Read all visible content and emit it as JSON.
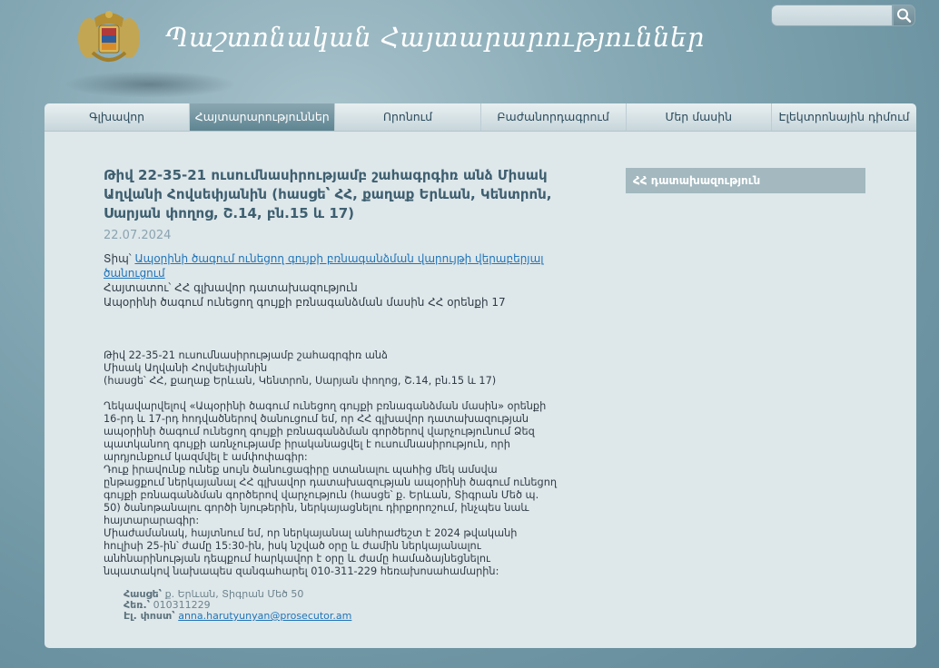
{
  "header": {
    "site_title": "Պաշտոնական Հայտարարություններ",
    "search": {
      "placeholder": "",
      "value": ""
    },
    "colors": {
      "accent": "#5f8592",
      "background": "#86a9b5"
    }
  },
  "nav": {
    "items": [
      {
        "label": "Գլխավոր",
        "active": false
      },
      {
        "label": "Հայտարարություններ",
        "active": true
      },
      {
        "label": "Որոնում",
        "active": false
      },
      {
        "label": "Բաժանորդագրում",
        "active": false
      },
      {
        "label": "Մեր մասին",
        "active": false
      },
      {
        "label": "Էլեկտրոնային դիմում",
        "active": false
      }
    ]
  },
  "announcement": {
    "title": "Թիվ 22-35-21 ուսումնասիրությամբ շահագրգիռ անձ Միսակ Աղվանի Հովսեփյանին (հասցե՝ ՀՀ, քաղաք Երևան, Կենտրոն, Սարյան փողոց, Շ.14, բն.15 և 17)",
    "date": "22.07.2024",
    "type_label": "Տիպ՝",
    "type_link": "Ապօրինի ծագում ունեցող գույքի բռնագանձման վարույթի վերաբերյալ ծանուցում",
    "announcer_label": "Հայտատու՝",
    "announcer": "ՀՀ գլխավոր դատախազություն",
    "law": "Ապօրինի ծագում ունեցող գույքի բռնագանձման մասին ՀՀ օրենքի 17",
    "addressee": "Թիվ 22-35-21 ուսումնասիրությամբ շահագրգիռ անձ\nՄիսակ Աղվանի Հովսեփյանին\n(հասցե՝ ՀՀ, քաղաք Երևան, Կենտրոն, Սարյան փողոց, Շ.14, բն.15 և 17)",
    "body": "Ղեկավարվելով «Ապօրինի ծագում ունեցող գույքի բռնագանձման մասին» օրենքի 16-րդ և 17-րդ հոդվածներով ծանուցում եմ, որ ՀՀ գլխավոր դատախազության ապօրինի ծագում ունեցող գույքի բռնագանձման գործերով վարչությունում Ձեզ պատկանող գույքի առնչությամբ իրականացվել է ուսումնասիրություն, որի արդյունքում կազմվել է ամփոփագիր:\nԴուք իրավունք ունեք սույն ծանուցագիրը ստանալու պահից մեկ ամսվա ընթացքում ներկայանալ ՀՀ գլխավոր դատախազության ապօրինի ծագում ունեցող գույքի բռնագանձման գործերով վարչություն (հասցե՝ ք. Երևան, Տիգրան Մեծ պ. 50) ծանոթանալու գործի նյութերին, ներկայացնելու դիրքորոշում, ինչպես նաև հայտարարագիր:\nՄիաժամանակ, հայտնում եմ, որ ներկայանալ անհրաժեշտ է 2024 թվականի հուլիսի 25-ին՝ ժամը 15:30-ին, իսկ նշված օրը և ժամին ներկայանալու անհնարինության դեպքում հարկավոր է օրը և ժամը համաձայնեցնելու նպատակով նախապես զանգահարել 010-311-229 հեռախոսահամարին:",
    "contacts": {
      "address_label": "Հասցե՝",
      "address": "ք. Երևան, Տիգրան Մեծ 50",
      "phone_label": "Հեռ.՝",
      "phone": "010311229",
      "email_label": "Էլ. փոստ՝",
      "email": "anna.harutyunyan@prosecutor.am"
    }
  },
  "sidebar": {
    "link_label": "ՀՀ դատախազություն"
  }
}
